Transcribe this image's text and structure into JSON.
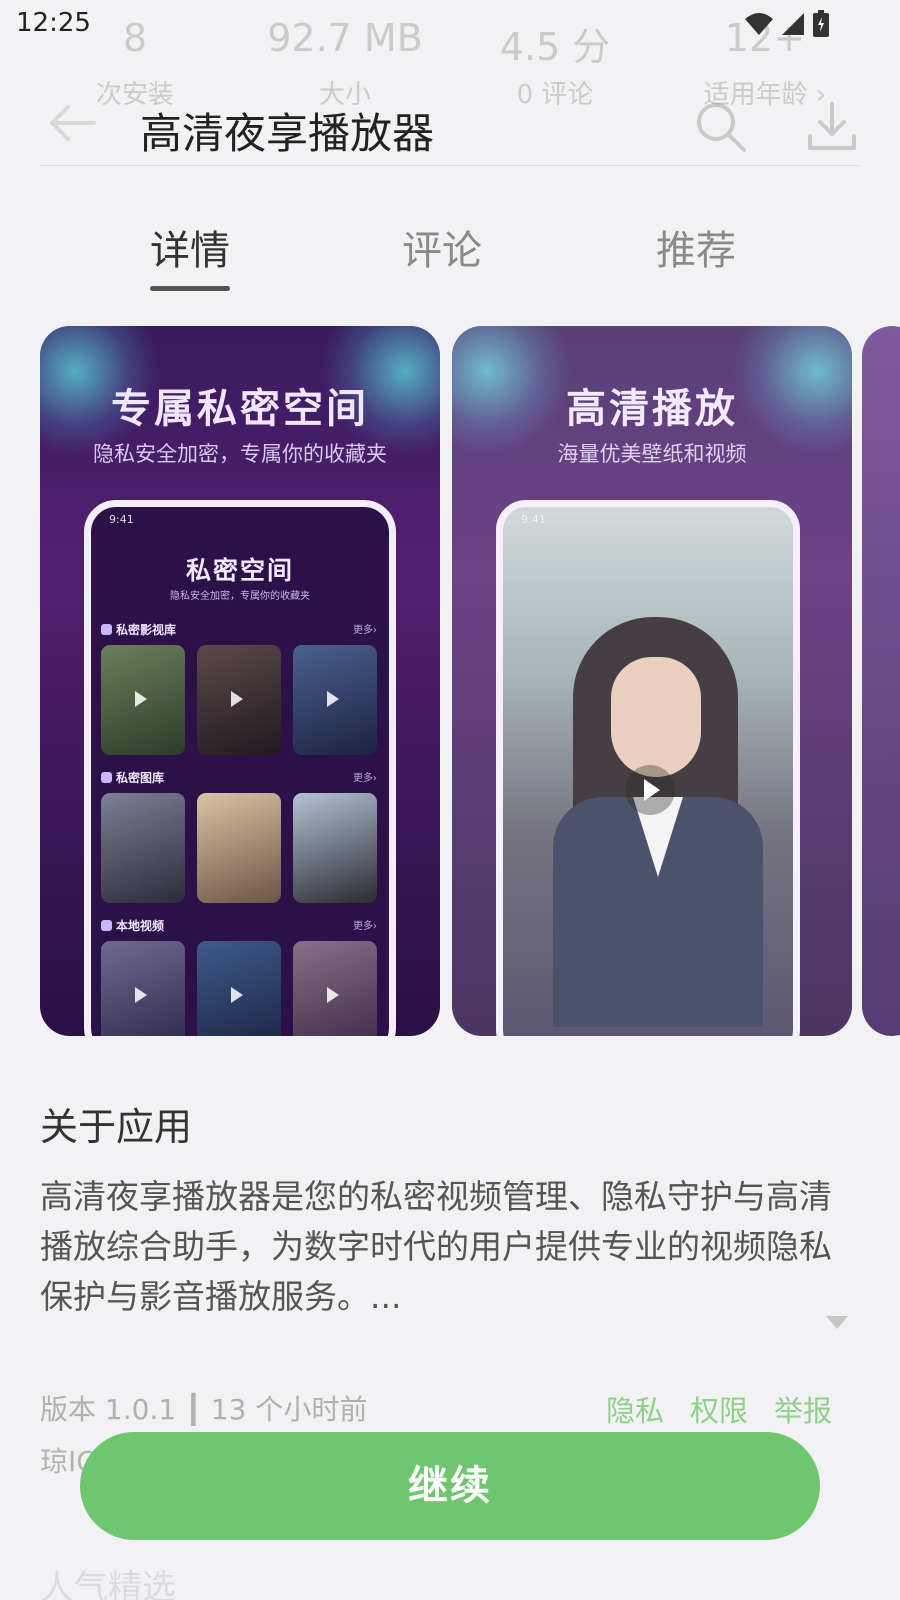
{
  "status_bar": {
    "time": "12:25"
  },
  "stats": [
    {
      "value": "8",
      "label": "次安装"
    },
    {
      "value": "92.7 MB",
      "label": "大小"
    },
    {
      "value": "4.5 分",
      "label": "0 评论"
    },
    {
      "value": "12+",
      "label": "适用年龄 ›"
    }
  ],
  "header": {
    "title": "高清夜享播放器"
  },
  "tabs": [
    {
      "label": "详情",
      "active": true
    },
    {
      "label": "评论",
      "active": false
    },
    {
      "label": "推荐",
      "active": false
    }
  ],
  "screenshots": [
    {
      "heading": "专属私密空间",
      "subheading": "隐私安全加密，专属你的收藏夹",
      "phone": {
        "time": "9:41",
        "title": "私密空间",
        "subtitle": "隐私安全加密，专属你的收藏夹",
        "sections": [
          {
            "label": "私密影视库",
            "more": "更多›"
          },
          {
            "label": "私密图库",
            "more": "更多›"
          },
          {
            "label": "本地视频",
            "more": "更多›"
          }
        ]
      }
    },
    {
      "heading": "高清播放",
      "subheading": "海量优美壁纸和视频",
      "phone": {
        "time": "9:41"
      }
    }
  ],
  "about": {
    "title": "关于应用",
    "text": "高清夜享播放器是您的私密视频管理、隐私守护与高清播放综合助手，为数字时代的用户提供专业的视频隐私保护与影音播放服务。..."
  },
  "meta": {
    "version": "版本 1.0.1 ┃ 13 个小时前",
    "developer": "琼IC",
    "links": [
      "隐私",
      "权限",
      "举报"
    ]
  },
  "next_section": "人气精选",
  "continue_button": "继续",
  "colors": {
    "accent": "#6fc66f",
    "link": "#8fd18a",
    "background": "#f2f2f4"
  }
}
